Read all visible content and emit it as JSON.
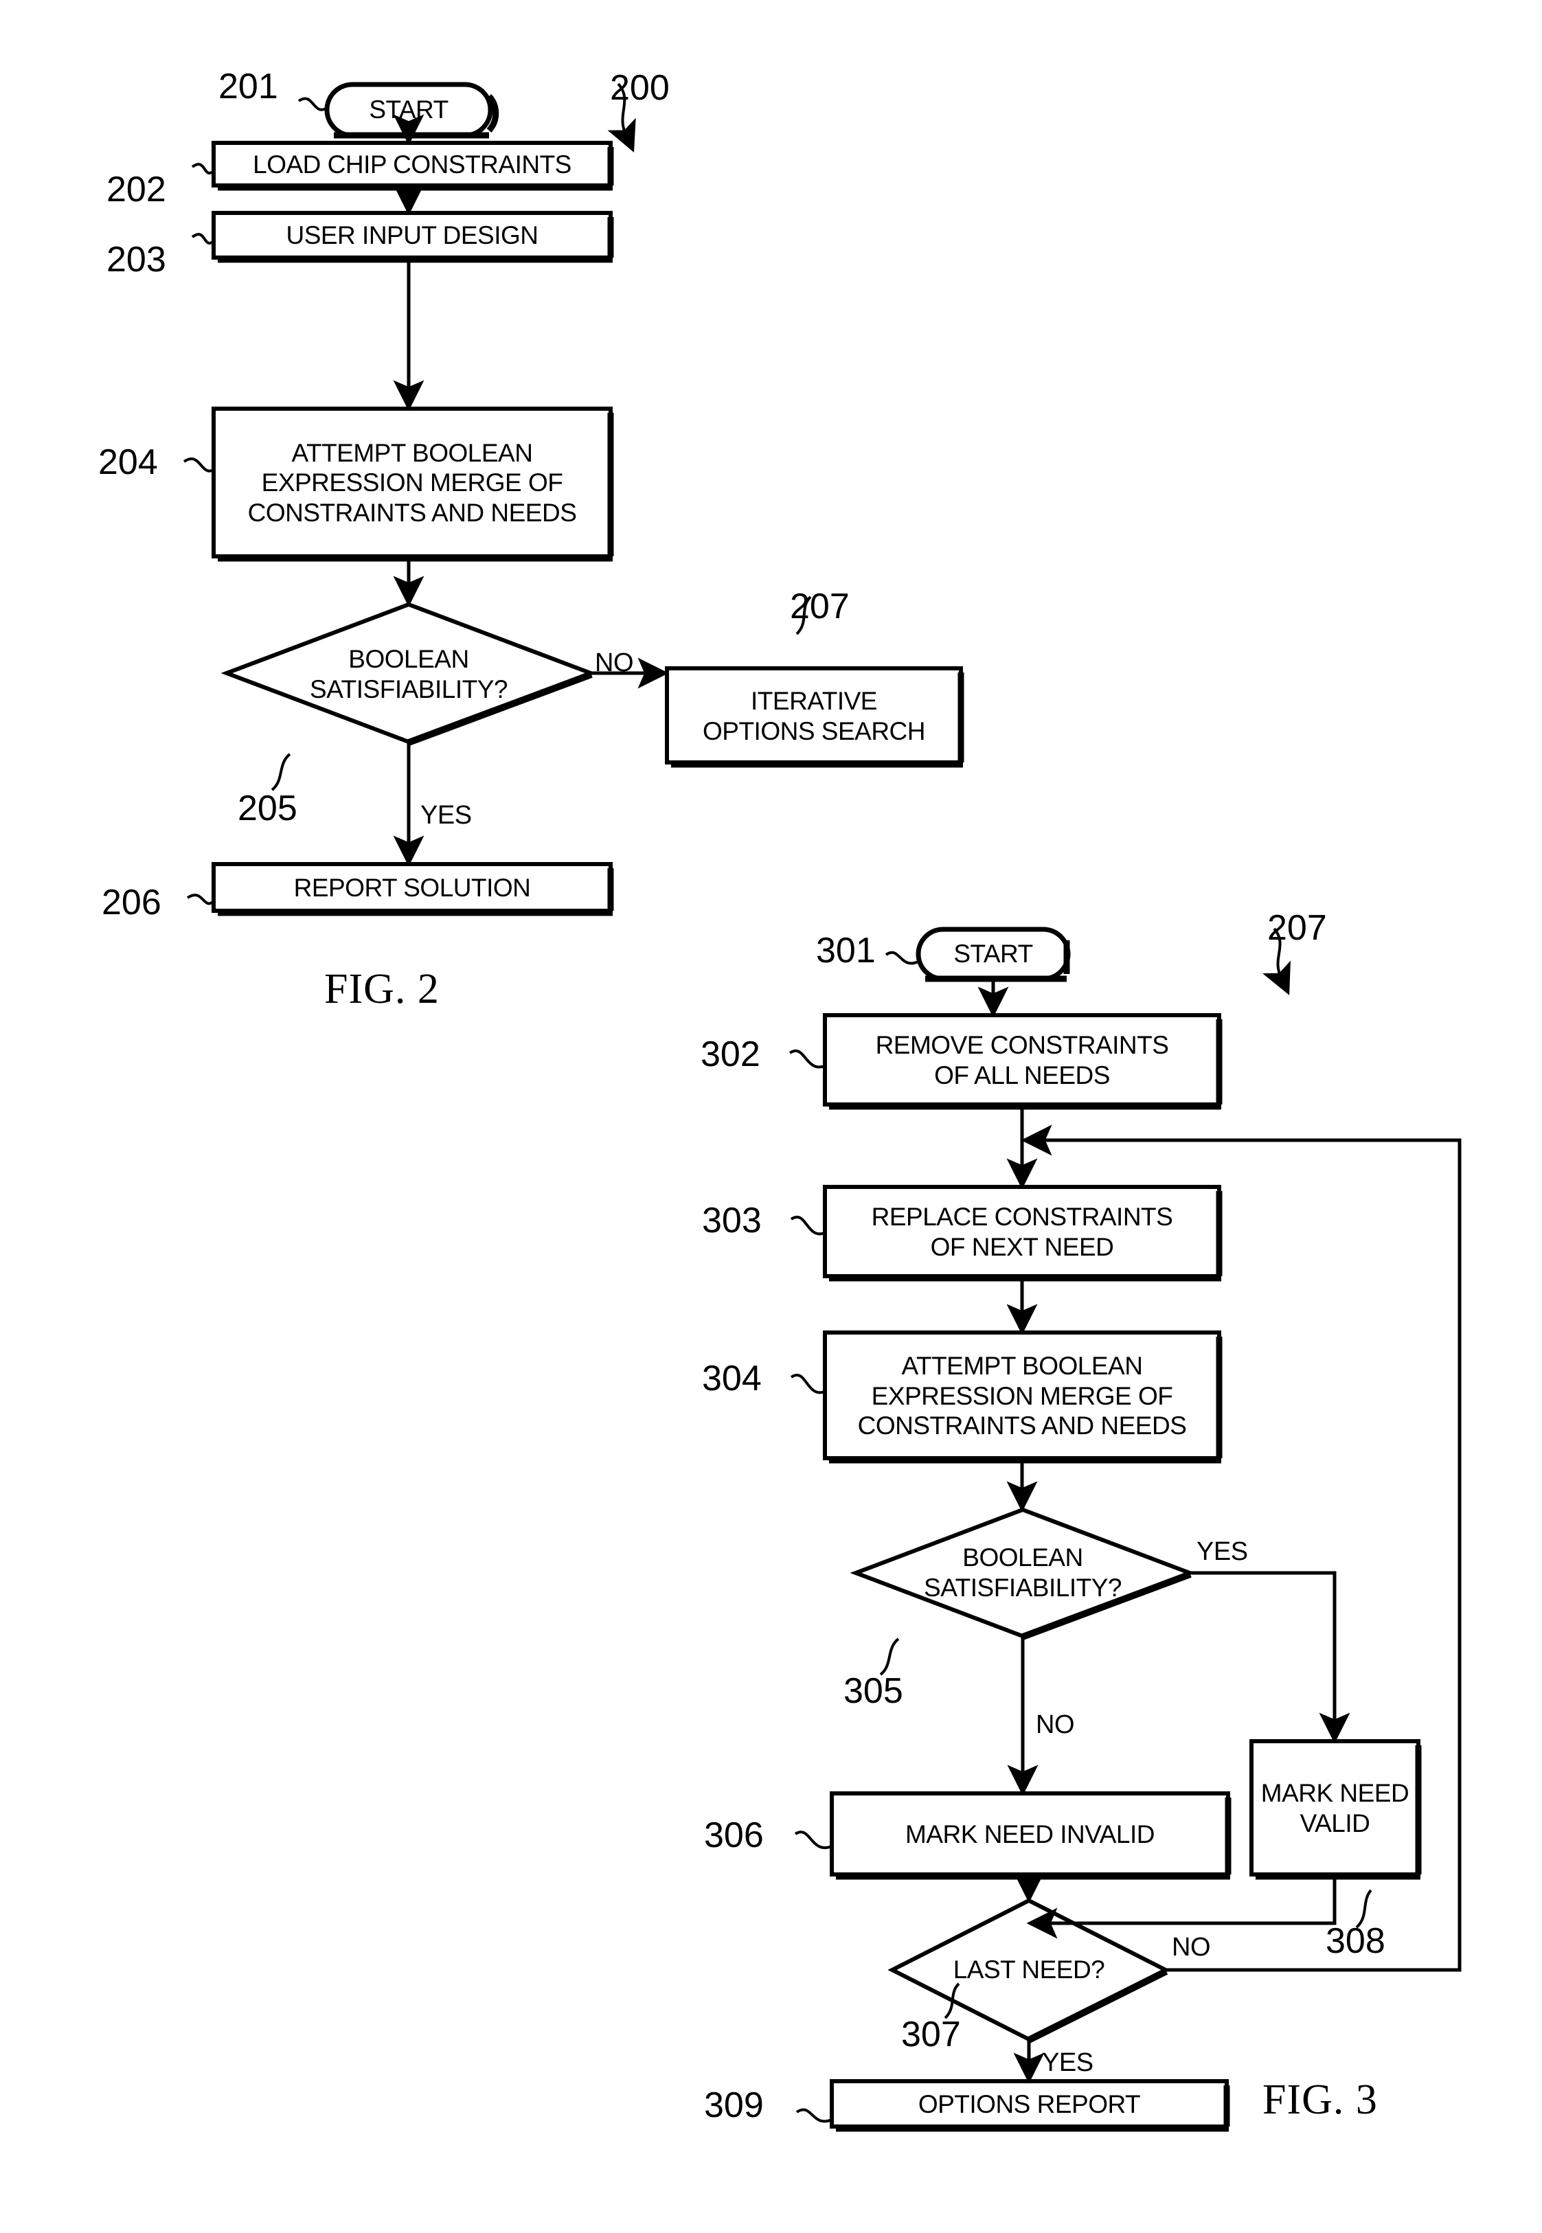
{
  "figures": [
    {
      "id": "fig2",
      "caption": "FIG. 2",
      "flow_ref": "200",
      "nodes": [
        {
          "ref": "201",
          "type": "terminator",
          "label": "START"
        },
        {
          "ref": "202",
          "type": "process",
          "label": "LOAD CHIP CONSTRAINTS"
        },
        {
          "ref": "203",
          "type": "process",
          "label": "USER INPUT DESIGN"
        },
        {
          "ref": "204",
          "type": "process",
          "label": "ATTEMPT BOOLEAN\nEXPRESSION MERGE OF\nCONSTRAINTS AND NEEDS"
        },
        {
          "ref": "205",
          "type": "decision",
          "label": "BOOLEAN\nSATISFIABILITY?"
        },
        {
          "ref": "206",
          "type": "process",
          "label": "REPORT SOLUTION"
        },
        {
          "ref": "207",
          "type": "process",
          "label": "ITERATIVE\nOPTIONS SEARCH"
        }
      ],
      "edge_labels": [
        {
          "id": "fig2-no",
          "text": "NO"
        },
        {
          "id": "fig2-yes",
          "text": "YES"
        }
      ]
    },
    {
      "id": "fig3",
      "caption": "FIG. 3",
      "flow_ref": "207",
      "nodes": [
        {
          "ref": "301",
          "type": "terminator",
          "label": "START"
        },
        {
          "ref": "302",
          "type": "process",
          "label": "REMOVE CONSTRAINTS\nOF ALL NEEDS"
        },
        {
          "ref": "303",
          "type": "process",
          "label": "REPLACE CONSTRAINTS\nOF NEXT NEED"
        },
        {
          "ref": "304",
          "type": "process",
          "label": "ATTEMPT BOOLEAN\nEXPRESSION MERGE OF\nCONSTRAINTS AND NEEDS"
        },
        {
          "ref": "305",
          "type": "decision",
          "label": "BOOLEAN\nSATISFIABILITY?"
        },
        {
          "ref": "306",
          "type": "process",
          "label": "MARK NEED INVALID"
        },
        {
          "ref": "307",
          "type": "decision",
          "label": "LAST NEED?"
        },
        {
          "ref": "308",
          "type": "process",
          "label": "MARK NEED\nVALID"
        },
        {
          "ref": "309",
          "type": "process",
          "label": "OPTIONS REPORT"
        }
      ],
      "edge_labels": [
        {
          "id": "fig3-yes-sat",
          "text": "YES"
        },
        {
          "id": "fig3-no-sat",
          "text": "NO"
        },
        {
          "id": "fig3-no-last",
          "text": "NO"
        },
        {
          "id": "fig3-yes-last",
          "text": "YES"
        }
      ]
    }
  ],
  "colors": {
    "ink": "#000000",
    "paper": "#ffffff"
  }
}
